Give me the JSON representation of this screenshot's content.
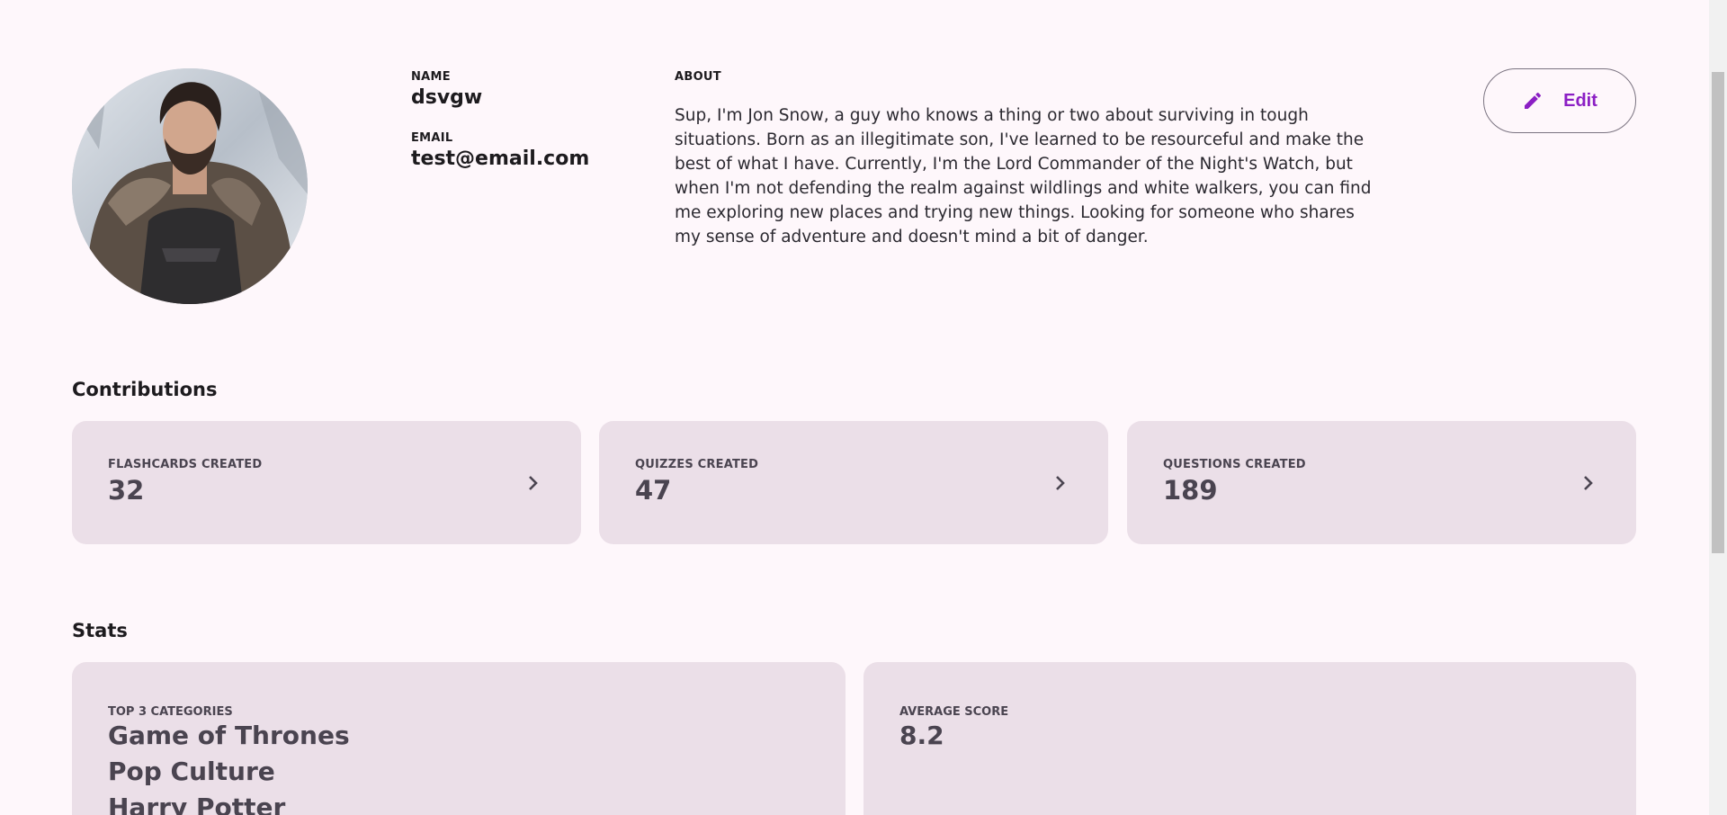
{
  "profile": {
    "name_label": "NAME",
    "name_value": "dsvgw",
    "email_label": "EMAIL",
    "email_value": "test@email.com",
    "about_label": "ABOUT",
    "about_text": "Sup, I'm Jon Snow, a guy who knows a thing or two about surviving in tough situations. Born as an illegitimate son, I've learned to be resourceful and make the best of what I have. Currently, I'm the Lord Commander of the Night's Watch, but when I'm not defending the realm against wildlings and white walkers, you can find me exploring new places and trying new things. Looking for someone who shares my sense of adventure and doesn't mind a bit of danger.",
    "edit_label": "Edit",
    "edit_icon": "pencil-icon"
  },
  "contributions": {
    "title": "Contributions",
    "cards": [
      {
        "label": "FLASHCARDS CREATED",
        "value": "32",
        "icon": "chevron-right-icon"
      },
      {
        "label": "QUIZZES CREATED",
        "value": "47",
        "icon": "chevron-right-icon"
      },
      {
        "label": "QUESTIONS CREATED",
        "value": "189",
        "icon": "chevron-right-icon"
      }
    ]
  },
  "stats": {
    "title": "Stats",
    "top_categories_label": "TOP 3 CATEGORIES",
    "top_categories": [
      "Game of Thrones",
      "Pop Culture",
      "Harry Potter"
    ],
    "average_score_label": "AVERAGE SCORE",
    "average_score": "8.2"
  },
  "colors": {
    "background": "#fef7fb",
    "card": "#ebdfe8",
    "accent": "#8b1fc4"
  }
}
